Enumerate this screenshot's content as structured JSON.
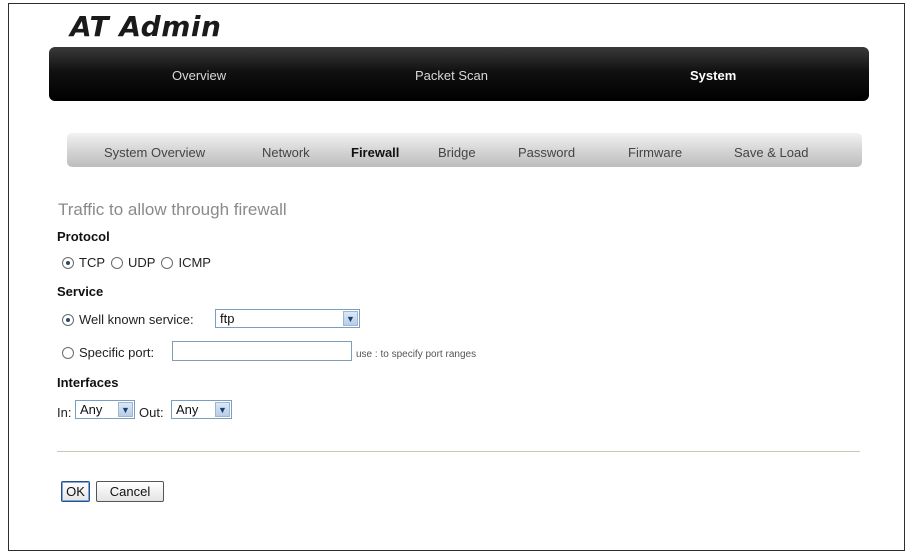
{
  "app": {
    "logo": "AT Admin"
  },
  "main_nav": [
    {
      "label": "Overview",
      "active": false
    },
    {
      "label": "Packet Scan",
      "active": false
    },
    {
      "label": "System",
      "active": true
    }
  ],
  "sub_nav": [
    {
      "label": "System Overview",
      "active": false
    },
    {
      "label": "Network",
      "active": false
    },
    {
      "label": "Firewall",
      "active": true
    },
    {
      "label": "Bridge",
      "active": false
    },
    {
      "label": "Password",
      "active": false
    },
    {
      "label": "Firmware",
      "active": false
    },
    {
      "label": "Save & Load",
      "active": false
    }
  ],
  "form": {
    "heading": "Traffic to allow through firewall",
    "protocol": {
      "label": "Protocol",
      "options": [
        "TCP",
        "UDP",
        "ICMP"
      ],
      "selected": "TCP"
    },
    "service": {
      "label": "Service",
      "well_known_label": "Well known service:",
      "well_known_value": "ftp",
      "specific_port_label": "Specific port:",
      "specific_port_value": "",
      "specific_port_hint": "use : to specify port ranges",
      "selected": "well_known"
    },
    "interfaces": {
      "label": "Interfaces",
      "in_label": "In:",
      "in_value": "Any",
      "out_label": "Out:",
      "out_value": "Any"
    }
  },
  "buttons": {
    "ok": "OK",
    "cancel": "Cancel"
  }
}
